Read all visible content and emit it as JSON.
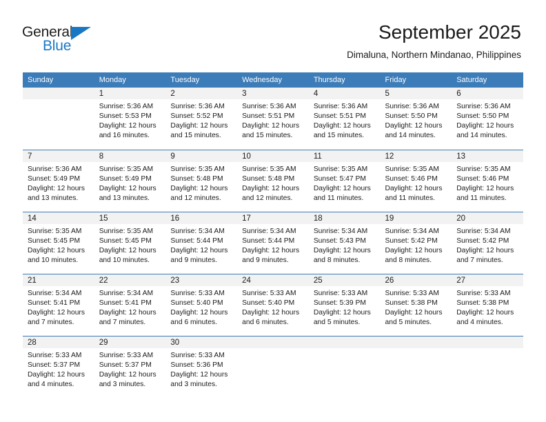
{
  "logo": {
    "line1": "General",
    "line2": "Blue",
    "triangle_color": "#1878c4",
    "text_color": "#1d1d1b"
  },
  "header": {
    "title": "September 2025",
    "subtitle": "Dimaluna, Northern Mindanao, Philippines"
  },
  "theme": {
    "header_band": "#3c7cb8",
    "daynum_band": "#f2f2f2",
    "text": "#1a1a1a"
  },
  "weekday_headers": [
    "Sunday",
    "Monday",
    "Tuesday",
    "Wednesday",
    "Thursday",
    "Friday",
    "Saturday"
  ],
  "weeks": [
    [
      {
        "day": "",
        "sunrise": "",
        "sunset": "",
        "daylight1": "",
        "daylight2": ""
      },
      {
        "day": "1",
        "sunrise": "Sunrise: 5:36 AM",
        "sunset": "Sunset: 5:53 PM",
        "daylight1": "Daylight: 12 hours",
        "daylight2": "and 16 minutes."
      },
      {
        "day": "2",
        "sunrise": "Sunrise: 5:36 AM",
        "sunset": "Sunset: 5:52 PM",
        "daylight1": "Daylight: 12 hours",
        "daylight2": "and 15 minutes."
      },
      {
        "day": "3",
        "sunrise": "Sunrise: 5:36 AM",
        "sunset": "Sunset: 5:51 PM",
        "daylight1": "Daylight: 12 hours",
        "daylight2": "and 15 minutes."
      },
      {
        "day": "4",
        "sunrise": "Sunrise: 5:36 AM",
        "sunset": "Sunset: 5:51 PM",
        "daylight1": "Daylight: 12 hours",
        "daylight2": "and 15 minutes."
      },
      {
        "day": "5",
        "sunrise": "Sunrise: 5:36 AM",
        "sunset": "Sunset: 5:50 PM",
        "daylight1": "Daylight: 12 hours",
        "daylight2": "and 14 minutes."
      },
      {
        "day": "6",
        "sunrise": "Sunrise: 5:36 AM",
        "sunset": "Sunset: 5:50 PM",
        "daylight1": "Daylight: 12 hours",
        "daylight2": "and 14 minutes."
      }
    ],
    [
      {
        "day": "7",
        "sunrise": "Sunrise: 5:36 AM",
        "sunset": "Sunset: 5:49 PM",
        "daylight1": "Daylight: 12 hours",
        "daylight2": "and 13 minutes."
      },
      {
        "day": "8",
        "sunrise": "Sunrise: 5:35 AM",
        "sunset": "Sunset: 5:49 PM",
        "daylight1": "Daylight: 12 hours",
        "daylight2": "and 13 minutes."
      },
      {
        "day": "9",
        "sunrise": "Sunrise: 5:35 AM",
        "sunset": "Sunset: 5:48 PM",
        "daylight1": "Daylight: 12 hours",
        "daylight2": "and 12 minutes."
      },
      {
        "day": "10",
        "sunrise": "Sunrise: 5:35 AM",
        "sunset": "Sunset: 5:48 PM",
        "daylight1": "Daylight: 12 hours",
        "daylight2": "and 12 minutes."
      },
      {
        "day": "11",
        "sunrise": "Sunrise: 5:35 AM",
        "sunset": "Sunset: 5:47 PM",
        "daylight1": "Daylight: 12 hours",
        "daylight2": "and 11 minutes."
      },
      {
        "day": "12",
        "sunrise": "Sunrise: 5:35 AM",
        "sunset": "Sunset: 5:46 PM",
        "daylight1": "Daylight: 12 hours",
        "daylight2": "and 11 minutes."
      },
      {
        "day": "13",
        "sunrise": "Sunrise: 5:35 AM",
        "sunset": "Sunset: 5:46 PM",
        "daylight1": "Daylight: 12 hours",
        "daylight2": "and 11 minutes."
      }
    ],
    [
      {
        "day": "14",
        "sunrise": "Sunrise: 5:35 AM",
        "sunset": "Sunset: 5:45 PM",
        "daylight1": "Daylight: 12 hours",
        "daylight2": "and 10 minutes."
      },
      {
        "day": "15",
        "sunrise": "Sunrise: 5:35 AM",
        "sunset": "Sunset: 5:45 PM",
        "daylight1": "Daylight: 12 hours",
        "daylight2": "and 10 minutes."
      },
      {
        "day": "16",
        "sunrise": "Sunrise: 5:34 AM",
        "sunset": "Sunset: 5:44 PM",
        "daylight1": "Daylight: 12 hours",
        "daylight2": "and 9 minutes."
      },
      {
        "day": "17",
        "sunrise": "Sunrise: 5:34 AM",
        "sunset": "Sunset: 5:44 PM",
        "daylight1": "Daylight: 12 hours",
        "daylight2": "and 9 minutes."
      },
      {
        "day": "18",
        "sunrise": "Sunrise: 5:34 AM",
        "sunset": "Sunset: 5:43 PM",
        "daylight1": "Daylight: 12 hours",
        "daylight2": "and 8 minutes."
      },
      {
        "day": "19",
        "sunrise": "Sunrise: 5:34 AM",
        "sunset": "Sunset: 5:42 PM",
        "daylight1": "Daylight: 12 hours",
        "daylight2": "and 8 minutes."
      },
      {
        "day": "20",
        "sunrise": "Sunrise: 5:34 AM",
        "sunset": "Sunset: 5:42 PM",
        "daylight1": "Daylight: 12 hours",
        "daylight2": "and 7 minutes."
      }
    ],
    [
      {
        "day": "21",
        "sunrise": "Sunrise: 5:34 AM",
        "sunset": "Sunset: 5:41 PM",
        "daylight1": "Daylight: 12 hours",
        "daylight2": "and 7 minutes."
      },
      {
        "day": "22",
        "sunrise": "Sunrise: 5:34 AM",
        "sunset": "Sunset: 5:41 PM",
        "daylight1": "Daylight: 12 hours",
        "daylight2": "and 7 minutes."
      },
      {
        "day": "23",
        "sunrise": "Sunrise: 5:33 AM",
        "sunset": "Sunset: 5:40 PM",
        "daylight1": "Daylight: 12 hours",
        "daylight2": "and 6 minutes."
      },
      {
        "day": "24",
        "sunrise": "Sunrise: 5:33 AM",
        "sunset": "Sunset: 5:40 PM",
        "daylight1": "Daylight: 12 hours",
        "daylight2": "and 6 minutes."
      },
      {
        "day": "25",
        "sunrise": "Sunrise: 5:33 AM",
        "sunset": "Sunset: 5:39 PM",
        "daylight1": "Daylight: 12 hours",
        "daylight2": "and 5 minutes."
      },
      {
        "day": "26",
        "sunrise": "Sunrise: 5:33 AM",
        "sunset": "Sunset: 5:38 PM",
        "daylight1": "Daylight: 12 hours",
        "daylight2": "and 5 minutes."
      },
      {
        "day": "27",
        "sunrise": "Sunrise: 5:33 AM",
        "sunset": "Sunset: 5:38 PM",
        "daylight1": "Daylight: 12 hours",
        "daylight2": "and 4 minutes."
      }
    ],
    [
      {
        "day": "28",
        "sunrise": "Sunrise: 5:33 AM",
        "sunset": "Sunset: 5:37 PM",
        "daylight1": "Daylight: 12 hours",
        "daylight2": "and 4 minutes."
      },
      {
        "day": "29",
        "sunrise": "Sunrise: 5:33 AM",
        "sunset": "Sunset: 5:37 PM",
        "daylight1": "Daylight: 12 hours",
        "daylight2": "and 3 minutes."
      },
      {
        "day": "30",
        "sunrise": "Sunrise: 5:33 AM",
        "sunset": "Sunset: 5:36 PM",
        "daylight1": "Daylight: 12 hours",
        "daylight2": "and 3 minutes."
      },
      {
        "day": "",
        "sunrise": "",
        "sunset": "",
        "daylight1": "",
        "daylight2": ""
      },
      {
        "day": "",
        "sunrise": "",
        "sunset": "",
        "daylight1": "",
        "daylight2": ""
      },
      {
        "day": "",
        "sunrise": "",
        "sunset": "",
        "daylight1": "",
        "daylight2": ""
      },
      {
        "day": "",
        "sunrise": "",
        "sunset": "",
        "daylight1": "",
        "daylight2": ""
      }
    ]
  ]
}
